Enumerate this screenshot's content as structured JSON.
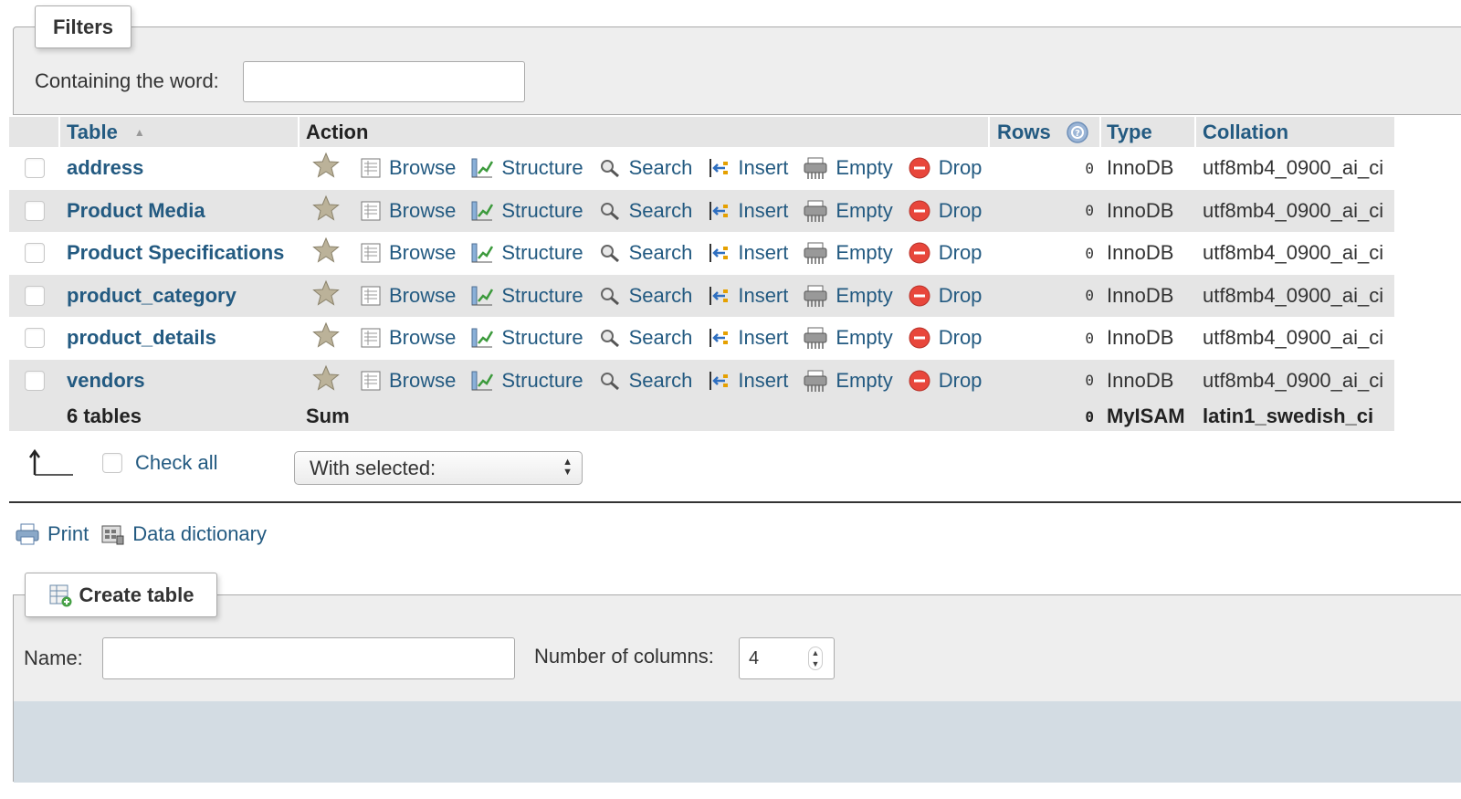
{
  "filters": {
    "legend": "Filters",
    "label": "Containing the word:",
    "value": ""
  },
  "table": {
    "headers": {
      "table": "Table",
      "action": "Action",
      "rows": "Rows",
      "type": "Type",
      "collation": "Collation"
    },
    "actions": {
      "browse": "Browse",
      "structure": "Structure",
      "search": "Search",
      "insert": "Insert",
      "empty": "Empty",
      "drop": "Drop"
    },
    "rows": [
      {
        "name": "address",
        "rows": "0",
        "type": "InnoDB",
        "collation": "utf8mb4_0900_ai_ci"
      },
      {
        "name": "Product Media",
        "rows": "0",
        "type": "InnoDB",
        "collation": "utf8mb4_0900_ai_ci"
      },
      {
        "name": "Product Specifications",
        "rows": "0",
        "type": "InnoDB",
        "collation": "utf8mb4_0900_ai_ci"
      },
      {
        "name": "product_category",
        "rows": "0",
        "type": "InnoDB",
        "collation": "utf8mb4_0900_ai_ci"
      },
      {
        "name": "product_details",
        "rows": "0",
        "type": "InnoDB",
        "collation": "utf8mb4_0900_ai_ci"
      },
      {
        "name": "vendors",
        "rows": "0",
        "type": "InnoDB",
        "collation": "utf8mb4_0900_ai_ci"
      }
    ],
    "footer": {
      "count": "6 tables",
      "sum": "Sum",
      "rows": "0",
      "type": "MyISAM",
      "collation": "latin1_swedish_ci"
    }
  },
  "bulk": {
    "check_all": "Check all",
    "with_selected": "With selected:"
  },
  "utilities": {
    "print": "Print",
    "data_dictionary": "Data dictionary"
  },
  "create_table": {
    "legend": "Create table",
    "name_label": "Name:",
    "name_value": "",
    "columns_label": "Number of columns:",
    "columns_value": "4"
  },
  "colors": {
    "link": "#235a81",
    "row_alt": "#e5e5e5",
    "fieldset_bg": "#eeeeee",
    "drop_red": "#e8463b"
  }
}
